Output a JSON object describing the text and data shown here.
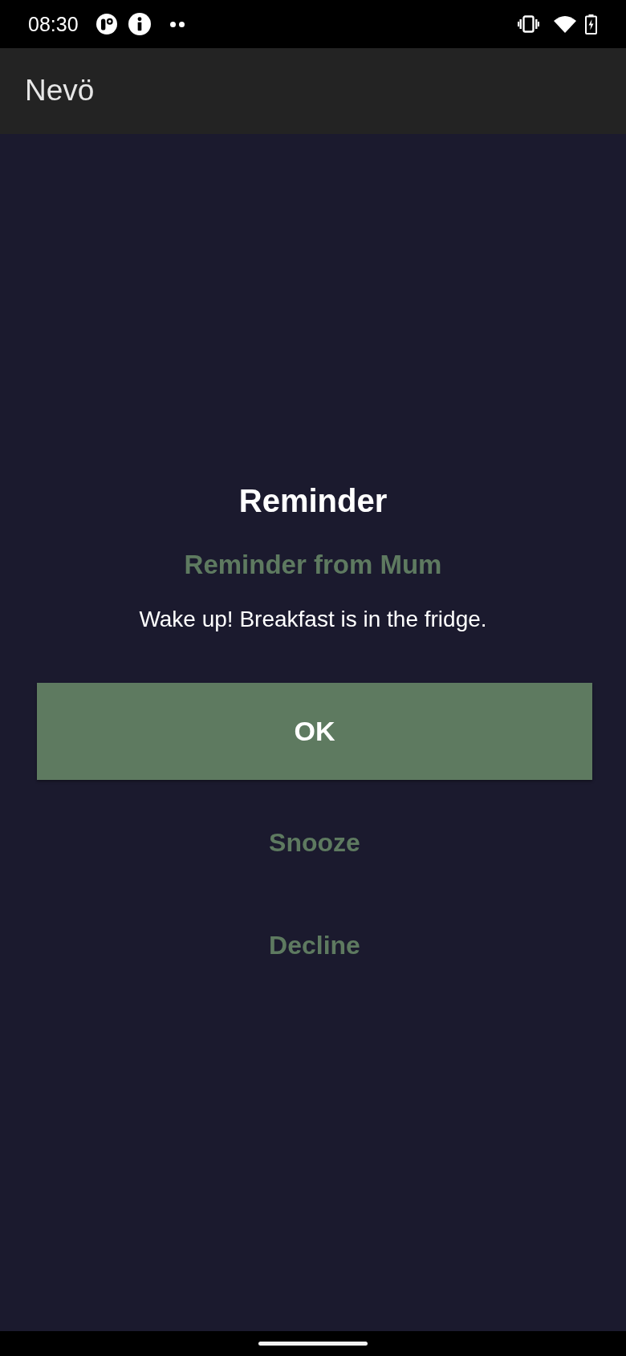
{
  "status_bar": {
    "time": "08:30"
  },
  "app_bar": {
    "title": "Nevö"
  },
  "reminder": {
    "title": "Reminder",
    "sender": "Reminder from Mum",
    "message": "Wake up! Breakfast is in the fridge.",
    "buttons": [
      {
        "label": "OK",
        "kind": "filled"
      },
      {
        "label": "Snooze",
        "kind": "text"
      },
      {
        "label": "Decline",
        "kind": "text"
      }
    ]
  }
}
